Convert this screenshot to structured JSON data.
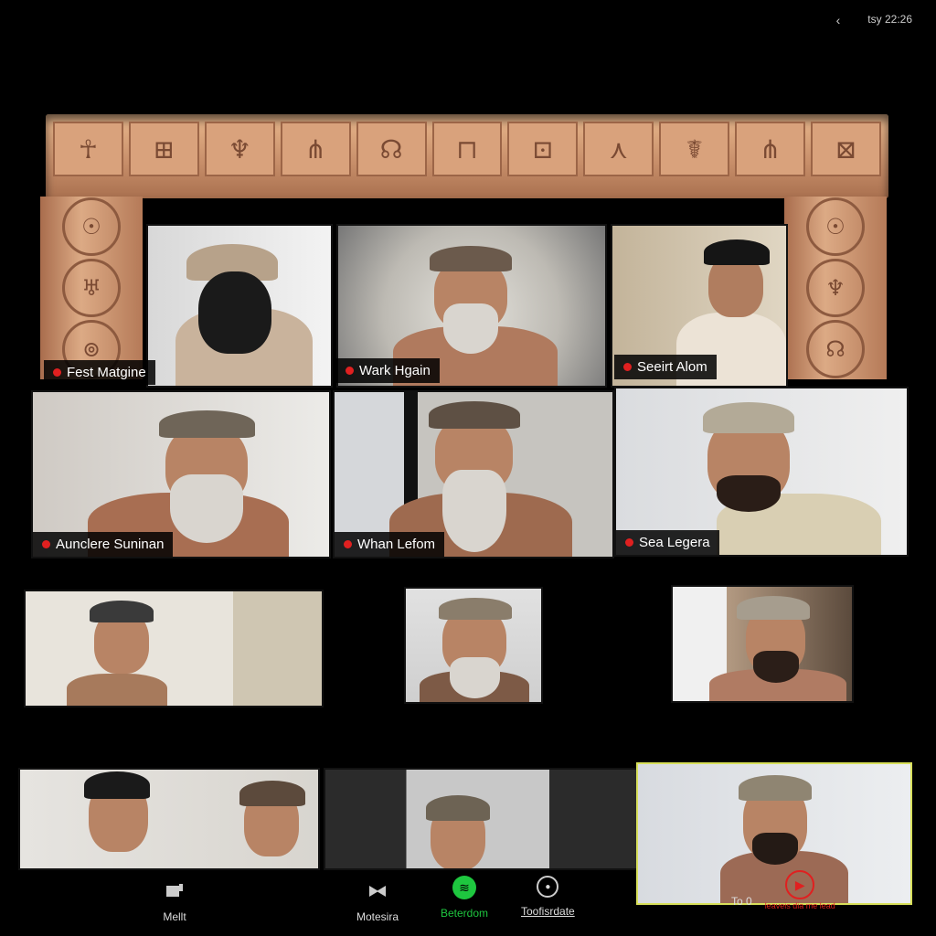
{
  "status_bar": {
    "time": "tsy 22:26",
    "back_glyph": "‹"
  },
  "frame": {
    "top_glyphs": [
      "☥",
      "⊞",
      "♆",
      "⋔",
      "☊",
      "⊓",
      "⊡",
      "⋏",
      "☤",
      "⋔",
      "⊠"
    ],
    "left_pillar": [
      "☉",
      "♅",
      "⊚"
    ],
    "right_pillar": [
      "☉",
      "♆",
      "☊"
    ]
  },
  "participants": [
    {
      "name": "Fest Matgine",
      "recording": true
    },
    {
      "name": "Wark Hgain",
      "recording": true
    },
    {
      "name": "Seeirt Alom",
      "recording": true
    },
    {
      "name": "Aunclere Suninan",
      "recording": true
    },
    {
      "name": "Whan Lefom",
      "recording": true
    },
    {
      "name": "Sea Legera",
      "recording": true
    }
  ],
  "toolbar": {
    "mute_label": "Mellt",
    "video_label": "Motesira",
    "share_label": "Beterdom",
    "record_label": "Toofisrdate",
    "end_label": "To 0",
    "end_sub": "leaveis dia me lead"
  },
  "icons": {
    "mute": "mic-icon",
    "video": "camera-icon",
    "share": "spotify-icon",
    "record": "record-icon",
    "end": "play-icon"
  },
  "colors": {
    "accent_green": "#1ec73f",
    "record_red": "#e02020",
    "active_border": "#d8e05a"
  }
}
